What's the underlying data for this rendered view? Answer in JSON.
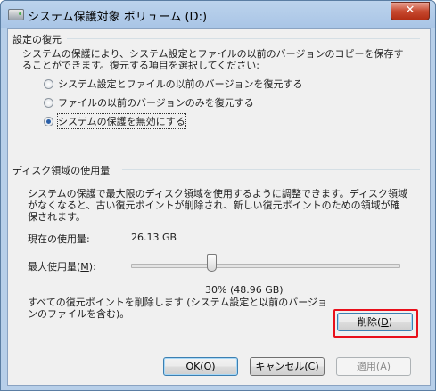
{
  "window": {
    "title": "システム保護対象 ボリューム (D:)",
    "close_glyph": "✕"
  },
  "restore_settings": {
    "group_title": "設定の復元",
    "description": "システムの保護により、システム設定とファイルの以前のバージョンのコピーを保存することができます。復元する項目を選択してください:",
    "options": [
      {
        "label": "システム設定とファイルの以前のバージョンを復元する",
        "checked": false
      },
      {
        "label": "ファイルの以前のバージョンのみを復元する",
        "checked": false
      },
      {
        "label": "システムの保護を無効にする",
        "checked": true
      }
    ]
  },
  "disk_usage": {
    "group_title": "ディスク領域の使用量",
    "description": "システムの保護で最大限のディスク領域を使用するように調整できます。ディスク領域がなくなると、古い復元ポイントが削除され、新しい復元ポイントのための領域が確保されます。",
    "current_label": "現在の使用量:",
    "current_value": "26.13 GB",
    "max_label": "最大使用量(",
    "max_label_key": "M",
    "max_label_end": "):",
    "slider_percent": 30,
    "slider_value_text": "30% (48.96 GB)",
    "delete_description": "すべての復元ポイントを削除します (システム設定と以前のバージョンのファイルを含む)。",
    "delete_label": "削除(",
    "delete_key": "D",
    "delete_end": ")"
  },
  "buttons": {
    "ok_label": "OK(O)",
    "cancel_label": "キャンセル(",
    "cancel_key": "C",
    "cancel_end": ")",
    "apply_label": "適用(",
    "apply_key": "A",
    "apply_end": ")"
  },
  "colors": {
    "highlight": "#e8101b",
    "close_button": "#c74a30"
  }
}
